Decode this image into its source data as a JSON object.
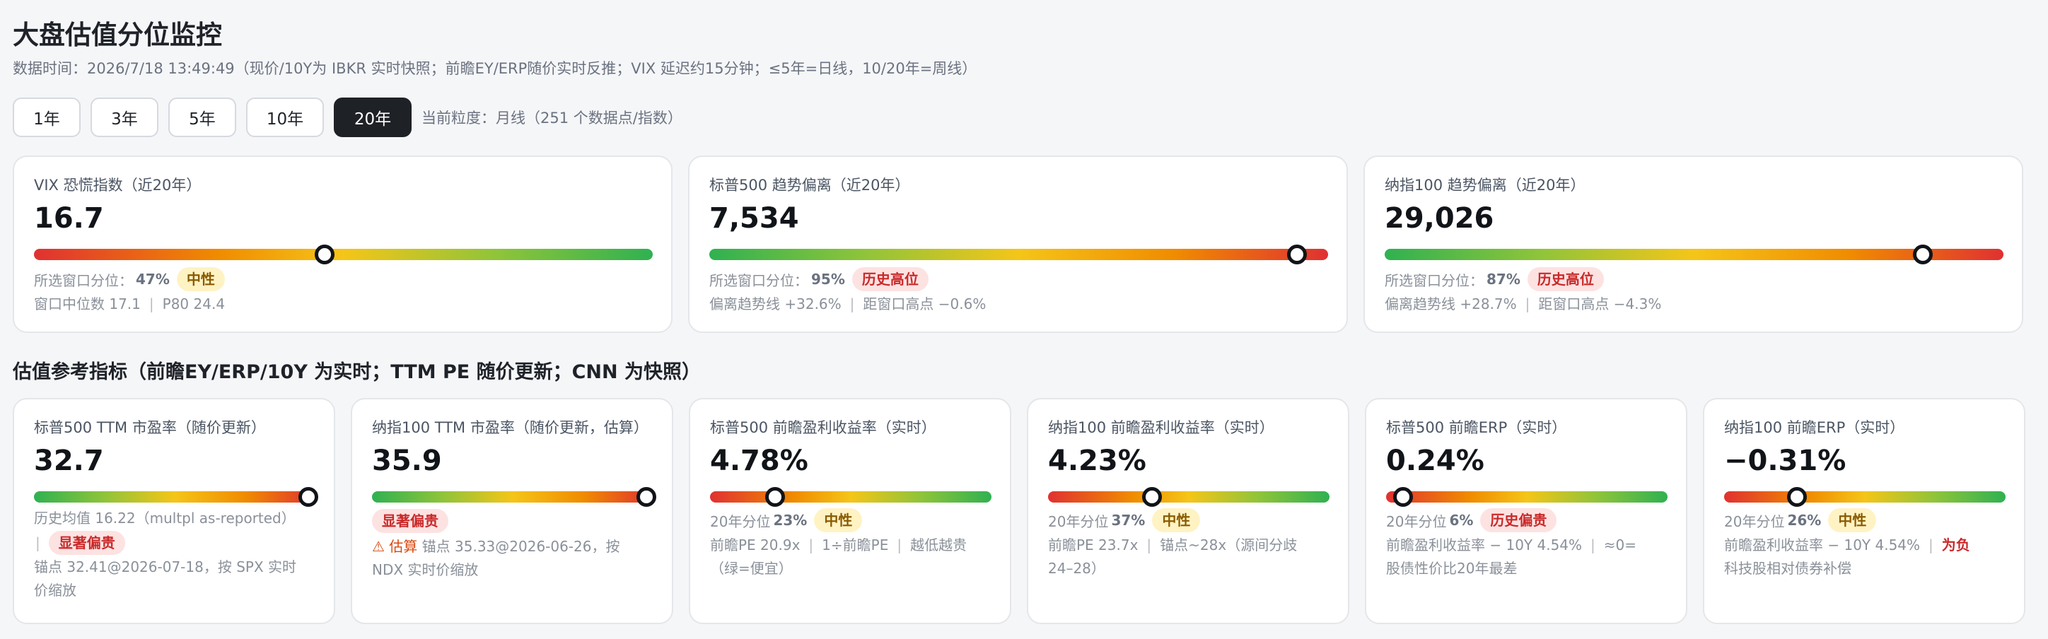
{
  "header": {
    "title": "大盘估值分位监控",
    "subtitle": "数据时间：2026/7/18 13:49:49（现价/10Y为 IBKR 实时快照；前瞻EY/ERP随价实时反推；VIX 延迟约15分钟；≤5年=日线，10/20年=周线）"
  },
  "toolbar": {
    "ranges": [
      "1年",
      "3年",
      "5年",
      "10年",
      "20年"
    ],
    "active_range": "20年",
    "granularity": "当前粒度：月线（251 个数据点/指数）"
  },
  "top_cards": [
    {
      "label": "VIX 恐慌指数（近20年）",
      "value": "16.7",
      "gradient": "red-green",
      "percentile": 0.47,
      "pct_label": "所选窗口分位：",
      "pct_text": "47%",
      "badge": "中性",
      "badge_type": "neutral",
      "detail_a": "窗口中位数 17.1",
      "detail_b": "P80 24.4"
    },
    {
      "label": "标普500 趋势偏离（近20年）",
      "value": "7,534",
      "gradient": "green-red",
      "percentile": 0.95,
      "pct_label": "所选窗口分位：",
      "pct_text": "95%",
      "badge": "历史高位",
      "badge_type": "high",
      "detail_a": "偏离趋势线 +32.6%",
      "detail_b": "距窗口高点 −0.6%"
    },
    {
      "label": "纳指100 趋势偏离（近20年）",
      "value": "29,026",
      "gradient": "green-red",
      "percentile": 0.87,
      "pct_label": "所选窗口分位：",
      "pct_text": "87%",
      "badge": "历史高位",
      "badge_type": "high",
      "detail_a": "偏离趋势线 +28.7%",
      "detail_b": "距窗口高点 −4.3%"
    }
  ],
  "section": {
    "title": "估值参考指标（前瞻EY/ERP/10Y 为实时；TTM PE 随价更新；CNN 为快照）"
  },
  "bottom_cards": [
    {
      "label": "标普500 TTM 市盈率（随价更新）",
      "value": "32.7",
      "gradient": "green-red",
      "percentile": 1.0,
      "line1": "历史均值 16.22（multpl as-reported）",
      "badge": "显著偏贵",
      "badge_type": "high",
      "line2": "锚点 32.41@2026-07-18，按 SPX 实时",
      "line3": "价缩放"
    },
    {
      "label": "纳指100 TTM 市盈率（随价更新，估算）",
      "value": "35.9",
      "gradient": "green-red",
      "percentile": 1.0,
      "badge": "显著偏贵",
      "badge_type": "high",
      "warn_icon": "⚠",
      "warn_text": "估算",
      "line1": "锚点 35.33@2026-06-26，按",
      "line2": "NDX 实时价缩放"
    },
    {
      "label": "标普500 前瞻盈利收益率（实时）",
      "value": "4.78%",
      "gradient": "red-green",
      "percentile": 0.23,
      "pct_label": "20年分位",
      "pct_text": "23%",
      "badge": "中性",
      "badge_type": "neutral",
      "line1a": "前瞻PE 20.9x",
      "line1b": "1÷前瞻PE",
      "line1c": "越低越贵",
      "line2": "（绿=便宜）"
    },
    {
      "label": "纳指100 前瞻盈利收益率（实时）",
      "value": "4.23%",
      "gradient": "red-green",
      "percentile": 0.37,
      "pct_label": "20年分位",
      "pct_text": "37%",
      "badge": "中性",
      "badge_type": "neutral",
      "line1a": "前瞻PE 23.7x",
      "line1b": "锚点~28x（源间分歧",
      "line2": "24–28）"
    },
    {
      "label": "标普500 前瞻ERP（实时）",
      "value": "0.24%",
      "gradient": "red-green",
      "percentile": 0.06,
      "pct_label": "20年分位",
      "pct_text": "6%",
      "badge": "历史偏贵",
      "badge_type": "high",
      "line1a": "前瞻盈利收益率 − 10Y 4.54%",
      "line1b": "≈0=",
      "line2": "股债性价比20年最差"
    },
    {
      "label": "纳指100 前瞻ERP（实时）",
      "value": "−0.31%",
      "gradient": "red-green",
      "percentile": 0.26,
      "pct_label": "20年分位",
      "pct_text": "26%",
      "badge": "中性",
      "badge_type": "neutral",
      "line1a": "前瞻盈利收益率 − 10Y 4.54%",
      "line1b": "为负",
      "line2": "科技股相对债券补偿"
    }
  ]
}
